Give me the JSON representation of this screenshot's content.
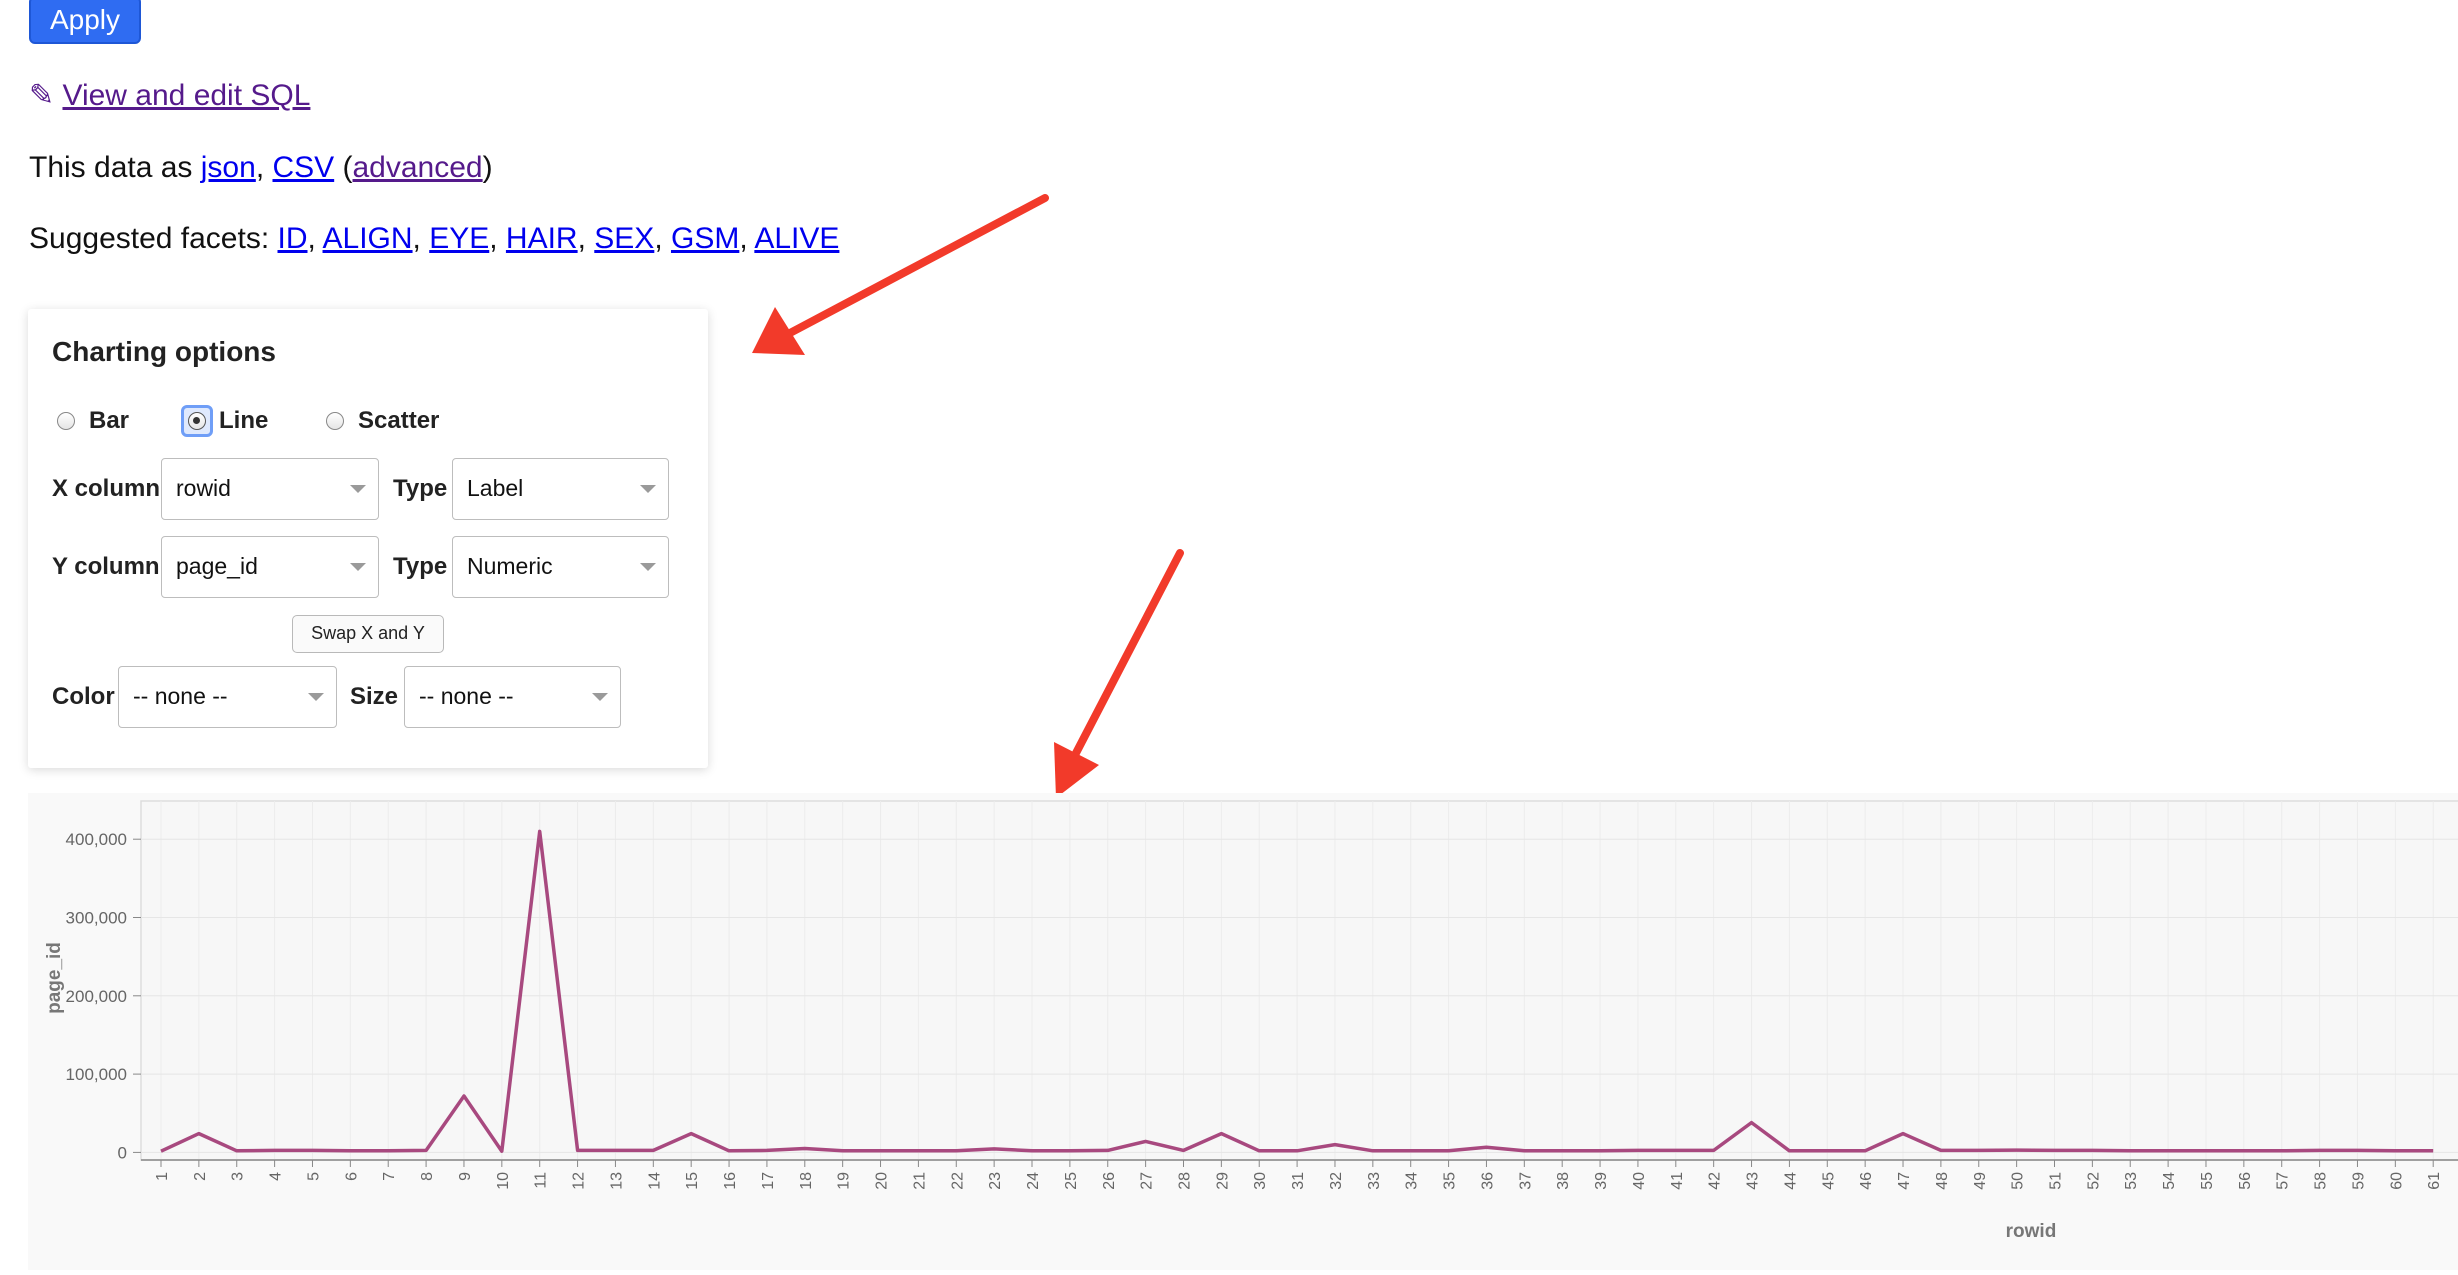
{
  "toolbar": {
    "apply_label": "Apply"
  },
  "sql_link": {
    "icon": "✎",
    "label": "View and edit SQL"
  },
  "data_as": {
    "prefix": "This data as ",
    "json": "json",
    "sep": ", ",
    "csv": "CSV",
    "open": " (",
    "advanced": "advanced",
    "close": ")"
  },
  "facets": {
    "prefix": "Suggested facets: ",
    "items": [
      "ID",
      "ALIGN",
      "EYE",
      "HAIR",
      "SEX",
      "GSM",
      "ALIVE"
    ]
  },
  "charting": {
    "title": "Charting options",
    "types": [
      {
        "label": "Bar",
        "checked": false
      },
      {
        "label": "Line",
        "checked": true
      },
      {
        "label": "Scatter",
        "checked": false
      }
    ],
    "x_column": {
      "label": "X column",
      "value": "rowid"
    },
    "x_type": {
      "label": "Type",
      "value": "Label"
    },
    "y_column": {
      "label": "Y column",
      "value": "page_id"
    },
    "y_type": {
      "label": "Type",
      "value": "Numeric"
    },
    "swap_label": "Swap X and Y",
    "color": {
      "label": "Color",
      "value": "-- none --"
    },
    "size": {
      "label": "Size",
      "value": "-- none --"
    }
  },
  "arrow_color": "#f23a2a",
  "chart_data": {
    "type": "line",
    "title": "",
    "xlabel": "rowid",
    "ylabel": "page_id",
    "ylim": [
      0,
      450000
    ],
    "yticks": [
      0,
      100000,
      200000,
      300000,
      400000
    ],
    "ytick_labels": [
      "0",
      "100,000",
      "200,000",
      "300,000",
      "400,000"
    ],
    "grid": true,
    "line_color": "#a8497f",
    "categories": [
      "1",
      "2",
      "3",
      "4",
      "5",
      "6",
      "7",
      "8",
      "9",
      "10",
      "11",
      "12",
      "13",
      "14",
      "15",
      "16",
      "17",
      "18",
      "19",
      "20",
      "21",
      "22",
      "23",
      "24",
      "25",
      "26",
      "27",
      "28",
      "29",
      "30",
      "31",
      "32",
      "33",
      "34",
      "35",
      "36",
      "37",
      "38",
      "39",
      "40",
      "41",
      "42",
      "43",
      "44",
      "45",
      "46",
      "47",
      "48",
      "49",
      "50",
      "51",
      "52",
      "53",
      "54",
      "55",
      "56",
      "57",
      "58",
      "59",
      "60",
      "61"
    ],
    "series": [
      {
        "values": [
          1500,
          24000,
          2000,
          2500,
          2500,
          2000,
          2000,
          2500,
          72000,
          1500,
          410000,
          2500,
          2500,
          2500,
          24000,
          2000,
          2500,
          5000,
          2000,
          2000,
          2000,
          2000,
          4500,
          2000,
          2000,
          2500,
          14000,
          2500,
          24000,
          2000,
          2000,
          10000,
          2000,
          2000,
          2000,
          6500,
          2000,
          2000,
          2000,
          2500,
          2500,
          2500,
          38000,
          2000,
          2000,
          2000,
          24000,
          2500,
          2500,
          3000,
          2500,
          2500,
          2000,
          2000,
          2000,
          2000,
          2000,
          2500,
          2500,
          2000,
          2000
        ]
      }
    ]
  }
}
